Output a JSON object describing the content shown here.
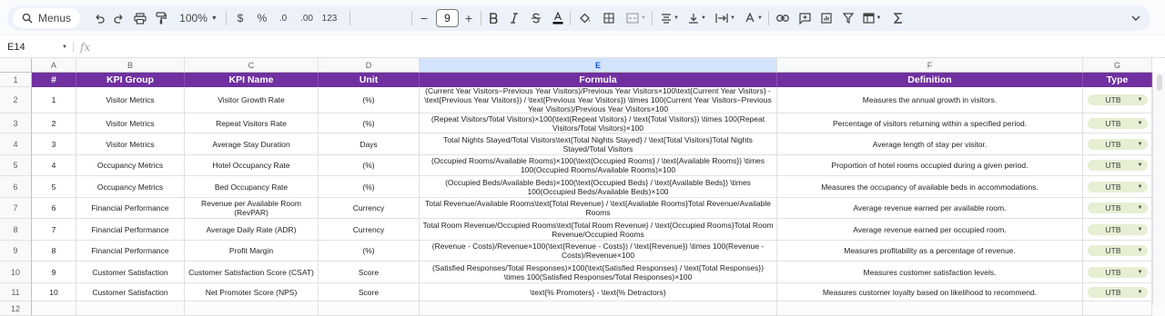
{
  "toolbar": {
    "menus_label": "Menus",
    "zoom": "100%",
    "currency": "$",
    "percent": "%",
    "dec_decrease": ".0",
    "dec_increase": ".00",
    "number_format": "123",
    "font_size": "9",
    "minus": "−",
    "plus": "+"
  },
  "formula_bar": {
    "name_box": "E14",
    "fx": "fx"
  },
  "columns": [
    "A",
    "B",
    "C",
    "D",
    "E",
    "F",
    "G"
  ],
  "selected_column": "E",
  "rows": [
    "1",
    "2",
    "3",
    "4",
    "5",
    "6",
    "7",
    "8",
    "9",
    "10",
    "11",
    "12"
  ],
  "header": [
    "#",
    "KPI Group",
    "KPI Name",
    "Unit",
    "Formula",
    "Definition",
    "Type"
  ],
  "data_rows": [
    {
      "num": "1",
      "group": "Visitor Metrics",
      "name": "Visitor Growth Rate",
      "unit": "(%)",
      "formula": "(Current Year Visitors−Previous Year Visitors)/Previous Year Visitors×100\\text{Current Year Visitors} - \\text{Previous Year Visitors}) / \\text{Previous Year Visitors}) \\times 100(Current Year Visitors−Previous Year Visitors)/Previous Year Visitors×100",
      "definition": "Measures the annual growth in visitors.",
      "type": "UTB"
    },
    {
      "num": "2",
      "group": "Visitor Metrics",
      "name": "Repeat Visitors Rate",
      "unit": "(%)",
      "formula": "(Repeat Visitors/Total Visitors)×100(\\text{Repeat Visitors} / \\text{Total Visitors}) \\times 100(Repeat Visitors/Total Visitors)×100",
      "definition": "Percentage of visitors returning within a specified period.",
      "type": "UTB"
    },
    {
      "num": "3",
      "group": "Visitor Metrics",
      "name": "Average Stay Duration",
      "unit": "Days",
      "formula": "Total Nights Stayed/Total Visitors\\text{Total Nights Stayed} / \\text{Total Visitors}Total Nights Stayed/Total Visitors",
      "definition": "Average length of stay per visitor.",
      "type": "UTB"
    },
    {
      "num": "4",
      "group": "Occupancy Metrics",
      "name": "Hotel Occupancy Rate",
      "unit": "(%)",
      "formula": "(Occupied Rooms/Available Rooms)×100(\\text{Occupied Rooms} / \\text{Available Rooms}) \\times 100(Occupied Rooms/Available Rooms)×100",
      "definition": "Proportion of hotel rooms occupied during a given period.",
      "type": "UTB"
    },
    {
      "num": "5",
      "group": "Occupancy Metrics",
      "name": "Bed Occupancy Rate",
      "unit": "(%)",
      "formula": "(Occupied Beds/Available Beds)×100(\\text{Occupied Beds} / \\text{Available Beds}) \\times 100(Occupied Beds/Available Beds)×100",
      "definition": "Measures the occupancy of available beds in accommodations.",
      "type": "UTB"
    },
    {
      "num": "6",
      "group": "Financial Performance",
      "name": "Revenue per Available Room (RevPAR)",
      "unit": "Currency",
      "formula": "Total Revenue/Available Rooms\\text{Total Revenue} / \\text{Available Rooms}Total Revenue/Available Rooms",
      "definition": "Average revenue earned per available room.",
      "type": "UTB"
    },
    {
      "num": "7",
      "group": "Financial Performance",
      "name": "Average Daily Rate (ADR)",
      "unit": "Currency",
      "formula": "Total Room Revenue/Occupied Rooms\\text{Total Room Revenue} / \\text{Occupied Rooms}Total Room Revenue/Occupied Rooms",
      "definition": "Average revenue earned per occupied room.",
      "type": "UTB"
    },
    {
      "num": "8",
      "group": "Financial Performance",
      "name": "Profit Margin",
      "unit": "(%)",
      "formula": "(Revenue - Costs)/Revenue×100(\\text{Revenue - Costs}) / \\text{Revenue}) \\times 100(Revenue - Costs)/Revenue×100",
      "definition": "Measures profitability as a percentage of revenue.",
      "type": "UTB"
    },
    {
      "num": "9",
      "group": "Customer Satisfaction",
      "name": "Customer Satisfaction Score (CSAT)",
      "unit": "Score",
      "formula": "(Satisfied Responses/Total Responses)×100(\\text{Satisfied Responses} / \\text{Total Responses}) \\times 100(Satisfied Responses/Total Responses)×100",
      "definition": "Measures customer satisfaction levels.",
      "type": "UTB"
    },
    {
      "num": "10",
      "group": "Customer Satisfaction",
      "name": "Net Promoter Score (NPS)",
      "unit": "Score",
      "formula": "\\text{% Promoters} - \\text{% Detractors}",
      "definition": "Measures customer loyalty based on likelihood to recommend.",
      "type": "UTB"
    }
  ],
  "colors": {
    "header_bg": "#7030a0",
    "chip_bg": "#e6efd3",
    "selected_col": "#d3e3fd"
  }
}
